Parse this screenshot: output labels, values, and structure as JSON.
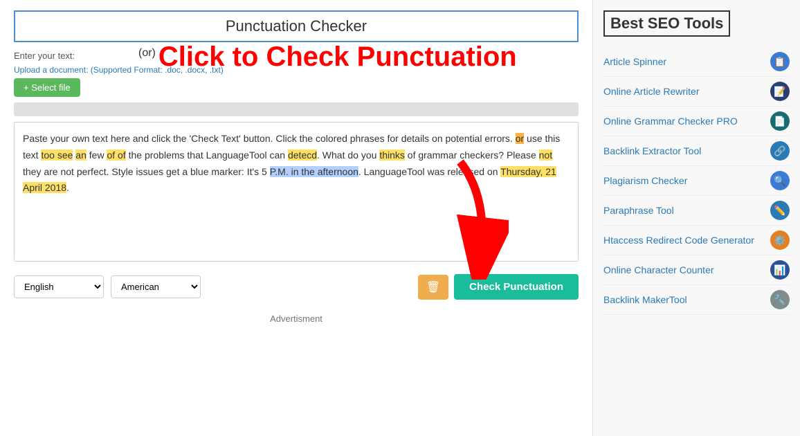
{
  "header": {
    "title": "Punctuation Checker"
  },
  "main": {
    "enter_text_label": "Enter your text:",
    "click_overlay_or": "(or)",
    "click_overlay_text": "Click to Check Punctuation",
    "upload_label": "Upload a document: (Supported Format: .doc, .docx, .txt)",
    "select_file_btn": "+ Select file",
    "editor_text_raw": "Paste your own text here and click the 'Check Text' button. Click the colored phrases for details on potential errors. or use this text too see an few of of the problems that LanguageTool can detecd. What do you thinks of grammar checkers? Please not they are not perfect. Style issues get a blue marker: It's 5 P.M. in the afternoon. LanguageTool was released on Thursday, 21 April 2018.",
    "bottom": {
      "language_label": "English",
      "dialect_label": "American",
      "check_btn": "Check Punctuation",
      "trash_btn": "🗑"
    }
  },
  "advertisement": {
    "label": "Advertisment"
  },
  "sidebar": {
    "title": "Best SEO Tools",
    "items": [
      {
        "label": "Article Spinner",
        "icon": "📋",
        "icon_class": "icon-blue"
      },
      {
        "label": "Online Article Rewriter",
        "icon": "📝",
        "icon_class": "icon-darkblue"
      },
      {
        "label": "Online Grammar Checker PRO",
        "icon": "📄",
        "icon_class": "icon-teal"
      },
      {
        "label": "Backlink Extractor Tool",
        "icon": "🔗",
        "icon_class": "icon-network"
      },
      {
        "label": "Plagiarism Checker",
        "icon": "🔍",
        "icon_class": "icon-blue"
      },
      {
        "label": "Paraphrase Tool",
        "icon": "✏️",
        "icon_class": "icon-edit"
      },
      {
        "label": "Htaccess Redirect Code Generator",
        "icon": "⚙️",
        "icon_class": "icon-orange"
      },
      {
        "label": "Online Character Counter",
        "icon": "📊",
        "icon_class": "icon-purple"
      },
      {
        "label": "Backlink MakerTool",
        "icon": "🔧",
        "icon_class": "icon-gray"
      }
    ]
  }
}
